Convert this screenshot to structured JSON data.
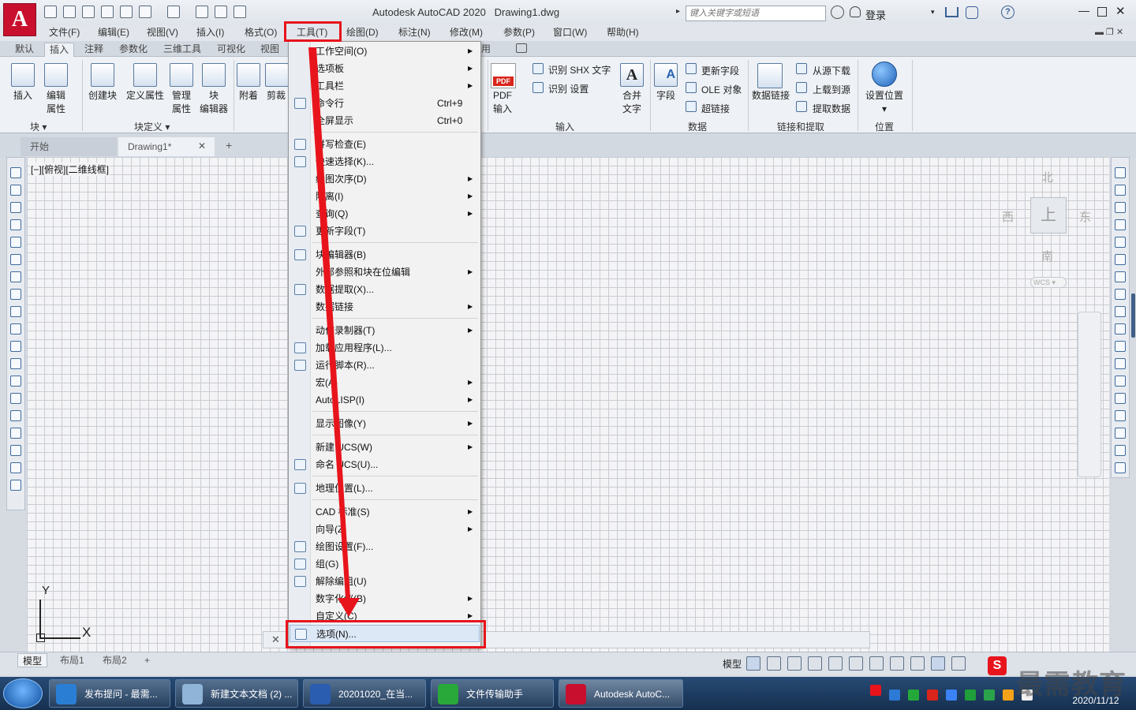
{
  "app": {
    "title": "Autodesk AutoCAD 2020",
    "filename": "Drawing1.dwg",
    "search_placeholder": "键入关键字或短语",
    "login": "登录",
    "logo": "A",
    "help": "?"
  },
  "menubar": [
    "文件(F)",
    "编辑(E)",
    "视图(V)",
    "插入(I)",
    "格式(O)",
    "工具(T)",
    "绘图(D)",
    "标注(N)",
    "修改(M)",
    "参数(P)",
    "窗口(W)",
    "帮助(H)"
  ],
  "ribbon_tabs": [
    "默认",
    "插入",
    "注释",
    "参数化",
    "三维工具",
    "可视化",
    "视图",
    "用"
  ],
  "ribbon": {
    "left": [
      {
        "l1": "插入",
        "l2": ""
      },
      {
        "l1": "编辑",
        "l2": "属性"
      },
      {
        "l1": "创建块",
        "l2": ""
      },
      {
        "l1": "定义属性",
        "l2": ""
      },
      {
        "l1": "管理",
        "l2": "属性"
      },
      {
        "l1": "块",
        "l2": "编辑器"
      },
      {
        "l1": "附着",
        "l2": ""
      },
      {
        "l1": "剪裁",
        "l2": ""
      }
    ],
    "groups": [
      "块",
      "块定义",
      "输入",
      "数据",
      "链接和提取",
      "位置"
    ],
    "pdf": {
      "badge": "PDF",
      "l1": "PDF",
      "l2": "输入"
    },
    "shx": [
      "识别 SHX 文字",
      "识别 设置"
    ],
    "merge": {
      "l1": "合并",
      "l2": "文字"
    },
    "field": "字段",
    "data_small": [
      "更新字段",
      "OLE 对象",
      "超链接"
    ],
    "datalink": "数据链接",
    "link_small": [
      "从源下载",
      "上载到源",
      "提取数据"
    ],
    "geoloc": {
      "l1": "设置位置"
    }
  },
  "doc_tabs": {
    "start": "开始",
    "drawing": "Drawing1*",
    "close": "✕",
    "add": "+"
  },
  "viewport_label": "[−][俯视][二维线框]",
  "viewcube": {
    "top": "上",
    "n": "北",
    "s": "南",
    "e": "东",
    "w": "西",
    "wcs": "WCS"
  },
  "ucs": {
    "x": "X",
    "y": "Y"
  },
  "menu_items": [
    {
      "label": "工作空间(O)",
      "shortcut": "",
      "sub": true,
      "icon": false
    },
    {
      "label": "选项板",
      "shortcut": "",
      "sub": true,
      "icon": false
    },
    {
      "label": "工具栏",
      "shortcut": "",
      "sub": true,
      "icon": false
    },
    {
      "label": "命令行",
      "shortcut": "Ctrl+9",
      "sub": false,
      "icon": true
    },
    {
      "label": "全屏显示",
      "shortcut": "Ctrl+0",
      "sub": false,
      "icon": false
    },
    {
      "label": "拼写检查(E)",
      "shortcut": "",
      "sub": false,
      "icon": true
    },
    {
      "label": "快速选择(K)...",
      "shortcut": "",
      "sub": false,
      "icon": true
    },
    {
      "label": "绘图次序(D)",
      "shortcut": "",
      "sub": true,
      "icon": false
    },
    {
      "label": "隔离(I)",
      "shortcut": "",
      "sub": true,
      "icon": false
    },
    {
      "label": "查询(Q)",
      "shortcut": "",
      "sub": true,
      "icon": false
    },
    {
      "label": "更新字段(T)",
      "shortcut": "",
      "sub": false,
      "icon": true
    },
    {
      "label": "块编辑器(B)",
      "shortcut": "",
      "sub": false,
      "icon": true
    },
    {
      "label": "外部参照和块在位编辑",
      "shortcut": "",
      "sub": true,
      "icon": false
    },
    {
      "label": "数据提取(X)...",
      "shortcut": "",
      "sub": false,
      "icon": true
    },
    {
      "label": "数据链接",
      "shortcut": "",
      "sub": true,
      "icon": false
    },
    {
      "label": "动作录制器(T)",
      "shortcut": "",
      "sub": true,
      "icon": false
    },
    {
      "label": "加载应用程序(L)...",
      "shortcut": "",
      "sub": false,
      "icon": true
    },
    {
      "label": "运行脚本(R)...",
      "shortcut": "",
      "sub": false,
      "icon": true
    },
    {
      "label": "宏(A)",
      "shortcut": "",
      "sub": true,
      "icon": false
    },
    {
      "label": "AutoLISP(I)",
      "shortcut": "",
      "sub": true,
      "icon": false
    },
    {
      "label": "显示图像(Y)",
      "shortcut": "",
      "sub": true,
      "icon": false
    },
    {
      "label": "新建 UCS(W)",
      "shortcut": "",
      "sub": true,
      "icon": false
    },
    {
      "label": "命名 UCS(U)...",
      "shortcut": "",
      "sub": false,
      "icon": true
    },
    {
      "label": "地理位置(L)...",
      "shortcut": "",
      "sub": false,
      "icon": true
    },
    {
      "label": "CAD 标准(S)",
      "shortcut": "",
      "sub": true,
      "icon": false
    },
    {
      "label": "向导(Z)",
      "shortcut": "",
      "sub": true,
      "icon": false
    },
    {
      "label": "绘图设置(F)...",
      "shortcut": "",
      "sub": false,
      "icon": true
    },
    {
      "label": "组(G)",
      "shortcut": "",
      "sub": false,
      "icon": true
    },
    {
      "label": "解除编组(U)",
      "shortcut": "",
      "sub": false,
      "icon": true
    },
    {
      "label": "数字化仪(B)",
      "shortcut": "",
      "sub": true,
      "icon": false
    },
    {
      "label": "自定义(C)",
      "shortcut": "",
      "sub": true,
      "icon": false
    },
    {
      "label": "选项(N)...",
      "shortcut": "",
      "sub": false,
      "icon": true
    }
  ],
  "layout_tabs": [
    "模型",
    "布局1",
    "布局2",
    "+"
  ],
  "status": {
    "model": "模型"
  },
  "taskbar": {
    "items": [
      "发布提问 - 最需...",
      "新建文本文档 (2) ...",
      "20201020_在当...",
      "文件传输助手",
      "Autodesk AutoC..."
    ],
    "date": "2020/11/12"
  },
  "watermark": "最需教育",
  "colors": {
    "highlight": "#e8141c",
    "autocad_red": "#c8102e",
    "taskbar": "#1e3d63"
  }
}
